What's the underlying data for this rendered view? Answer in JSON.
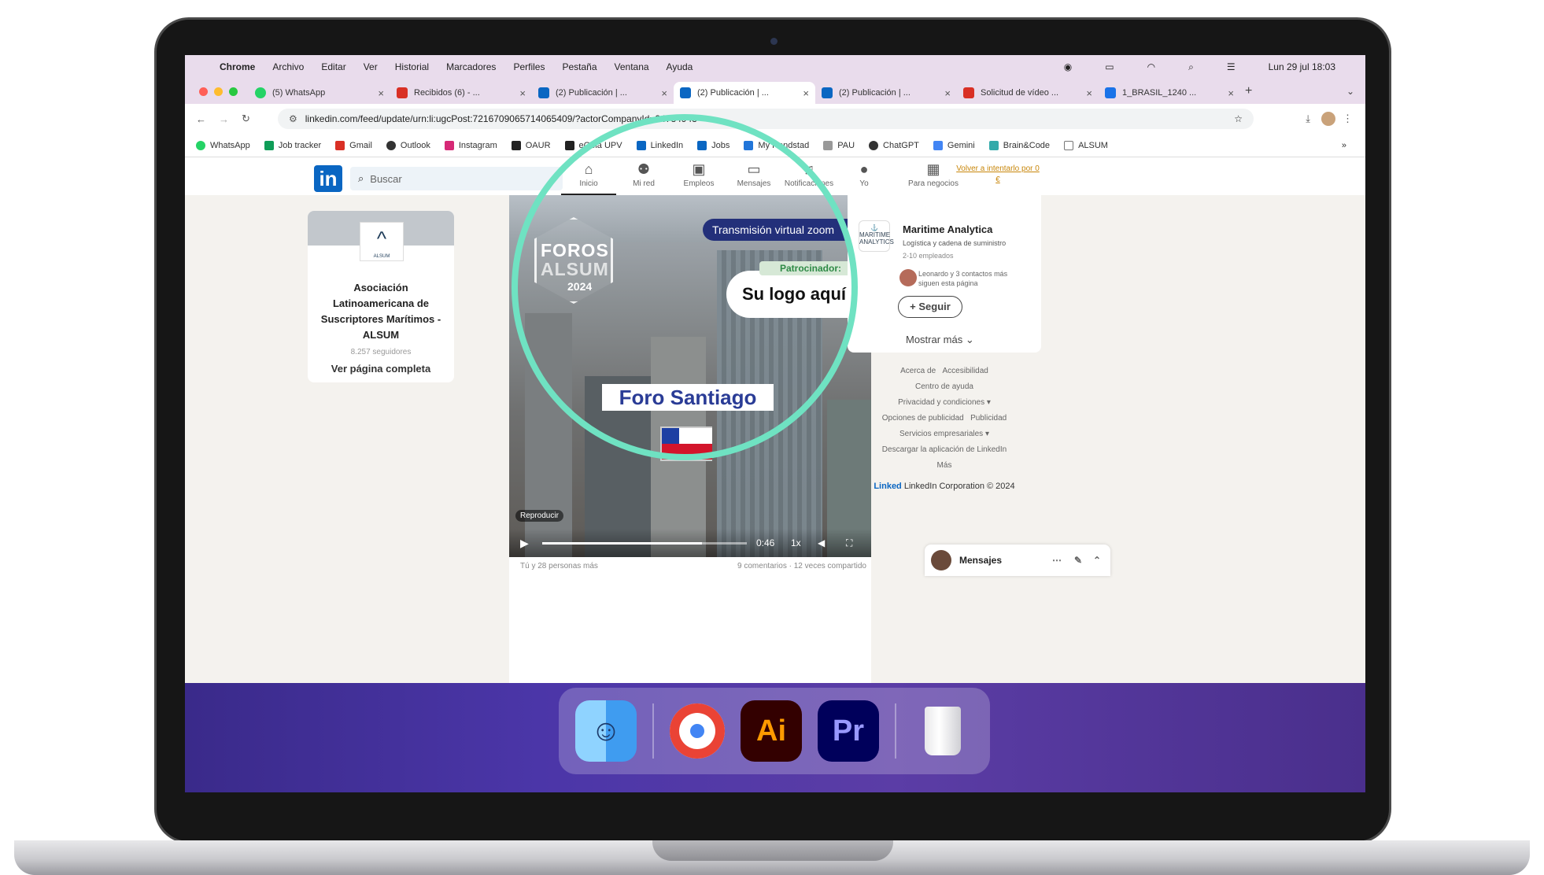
{
  "menubar": {
    "apple": "",
    "items": [
      "Chrome",
      "Archivo",
      "Editar",
      "Ver",
      "Historial",
      "Marcadores",
      "Perfiles",
      "Pestaña",
      "Ventana",
      "Ayuda"
    ],
    "clock": "Lun 29 jul 18:03"
  },
  "tabs": [
    {
      "label": "(5) WhatsApp",
      "color": "#25d366"
    },
    {
      "label": "Recibidos (6) - ...",
      "color": "#d93025"
    },
    {
      "label": "(2) Publicación | ...",
      "color": "#0a66c2"
    },
    {
      "label": "(2) Publicación | ...",
      "color": "#0a66c2",
      "active": true
    },
    {
      "label": "(2) Publicación | ...",
      "color": "#0a66c2"
    },
    {
      "label": "Solicitud de vídeo ...",
      "color": "#d93025"
    },
    {
      "label": "1_BRASIL_1240 ...",
      "color": "#1a73e8"
    }
  ],
  "address": {
    "url": "linkedin.com/feed/update/urn:li:ugcPost:7216709065714065409/?actorCompanyId=24784943"
  },
  "bookmarks": [
    "WhatsApp",
    "Job tracker",
    "Gmail",
    "Outlook",
    "Instagram",
    "OAUR",
    "eGela UPV",
    "LinkedIn",
    "Jobs",
    "My Randstad",
    "PAU",
    "ChatGPT",
    "Gemini",
    "Brain&Code",
    "ALSUM"
  ],
  "linkedin": {
    "logo": "in",
    "search_placeholder": "Buscar",
    "nav": [
      "Inicio",
      "Mi red",
      "Empleos",
      "Mensajes",
      "Notificaciones",
      "Yo",
      "Para negocios"
    ],
    "upgrade": "Volver a intentarlo por 0 €"
  },
  "company_card": {
    "logo_text": "ALSUM",
    "name": "Asociación Latinoamericana de Suscriptores Marítimos - ALSUM",
    "followers": "8.257 seguidores",
    "view": "Ver página completa"
  },
  "video": {
    "foros": "FOROS",
    "alsum": "ALSUM",
    "year": "2024",
    "transmission": "Transmisión virtual zoom",
    "sponsor": "Patrocinador:",
    "logo_here": "Su logo aquí",
    "forum": "Foro Santiago",
    "repro": "Reproducir",
    "time": "0:46",
    "speed": "1x",
    "progress": 0.78
  },
  "reactions": {
    "left": "Tú y 28 personas más",
    "right": "9 comentarios · 12 veces compartido"
  },
  "suggest": {
    "name": "Maritime Analytica",
    "desc": "Logística y cadena de suministro",
    "employees": "2-10 empleados",
    "connections": "Leonardo y 3 contactos más siguen esta página",
    "follow": "+ Seguir",
    "more": "Mostrar más"
  },
  "footer": [
    "Acerca de",
    "Accesibilidad",
    "Centro de ayuda",
    "Privacidad y condiciones",
    "Opciones de publicidad",
    "Publicidad",
    "Servicios empresariales",
    "Descargar la aplicación de LinkedIn",
    "Más"
  ],
  "copyright": "LinkedIn Corporation © 2024",
  "copyright_brand": "Linked",
  "messages": "Mensajes",
  "dock": [
    {
      "name": "finder",
      "label": "☺",
      "bg": "#4aa8f0",
      "fg": "#1d3a6a"
    },
    {
      "name": "chrome",
      "label": "",
      "bg": "#ffffff",
      "fg": "#333"
    },
    {
      "name": "illustrator",
      "label": "Ai",
      "bg": "#330000",
      "fg": "#ff9a00"
    },
    {
      "name": "premiere",
      "label": "Pr",
      "bg": "#00005b",
      "fg": "#9999ff"
    },
    {
      "name": "trash",
      "label": "",
      "bg": "transparent",
      "fg": "#ccc"
    }
  ],
  "colors": {
    "menubar": "#e9dcec",
    "linkedin": "#0a66c2",
    "highlight": "#6fe2c2",
    "dock": "#4b36a8"
  }
}
